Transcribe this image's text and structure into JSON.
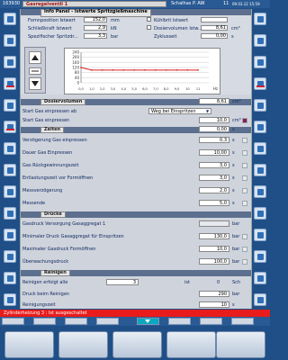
{
  "topbar": {
    "id": "163930",
    "title": "Gasregelventil 1",
    "user": "Schalhas P. AW",
    "counter": "11",
    "datetime": "09.03.12 15:59"
  },
  "info_panel": {
    "title": "Info Panel - Istwerte Spritzgießmaschine",
    "rows": [
      {
        "label": "Fornnposition Istwert",
        "value": "152,0",
        "unit": "mm",
        "cb_label": "Kühlbrit Istwert",
        "cb_value": "",
        "cb_unit": ""
      },
      {
        "label": "Schließkraft Istwert",
        "value": "2,9",
        "unit": "kN",
        "cb_label": "Dosiervolumen Istw...",
        "cb_value": "8,61",
        "cb_unit": "cm³"
      },
      {
        "label": "Spezifischer Spritzdr...",
        "value": "3,3",
        "unit": "bar",
        "cb_label": "Zyklusseit",
        "cb_value": "0,00",
        "cb_unit": "s"
      }
    ]
  },
  "chart_data": {
    "type": "line",
    "x": [
      0.0,
      1.0,
      2.0,
      3.0,
      4.0,
      5.0,
      6.0,
      7.0,
      8.0,
      9.0,
      10.0,
      11.0
    ],
    "values": [
      120,
      100,
      100,
      100,
      100,
      100,
      100,
      100,
      100,
      100,
      100,
      100
    ],
    "yticks": [
      "240",
      "200",
      "160",
      "120",
      "80",
      "40",
      "0"
    ],
    "xticks": [
      "0,0",
      "1,0",
      "2,0",
      "3,0",
      "4,0",
      "5,0",
      "6,0",
      "7,0",
      "8,0",
      "9,0",
      "10",
      "11"
    ],
    "xunit": "Hz",
    "ylim": [
      0,
      240
    ],
    "xlim": [
      0,
      12
    ]
  },
  "dosiervolumen": {
    "title": "Dosiervolumen",
    "value": "8,61",
    "unit": "cm³"
  },
  "start": {
    "rows": [
      {
        "label": "Start Gas einpressen ab",
        "value": "Weg bei Einspritzen",
        "unit": ""
      },
      {
        "label": "Start Gas einpressen",
        "value": "10,0",
        "unit": "cm³"
      }
    ]
  },
  "zeiten": {
    "title": "Zeiten",
    "value": "0,00",
    "unit": "s",
    "rows": [
      {
        "label": "Verzögerung Gas einpressen",
        "value": "0,3",
        "unit": "s"
      },
      {
        "label": "Dauer Gas Einpressen",
        "value": "10,00",
        "unit": "s"
      },
      {
        "label": "Gas Rückgewinnungszeit",
        "value": "3,0",
        "unit": "s"
      },
      {
        "label": "Entlastungszeit vor Formöffnen",
        "value": "3,0",
        "unit": "s"
      },
      {
        "label": "Messverzögerung",
        "value": "2,0",
        "unit": "s"
      },
      {
        "label": "Messende",
        "value": "5,0",
        "unit": "s"
      }
    ]
  },
  "druecke": {
    "title": "Drücke",
    "rows": [
      {
        "label": "Gasdruck Versorgung Gasaggregat 1",
        "value": "",
        "unit": "bar"
      },
      {
        "label": "Minimaler Druck Gasaggregat für Einspritzen",
        "value": "130,0",
        "unit": "bar"
      },
      {
        "label": "Maximaler Gasdruck Formöffnen",
        "value": "10,0",
        "unit": "bar"
      },
      {
        "label": "Überwachungsdruck",
        "value": "100,0",
        "unit": "bar"
      }
    ]
  },
  "reinigen": {
    "title": "Reinigen",
    "rows": [
      {
        "label": "Reinigen erfolgt alle",
        "value": "3",
        "ist_label": "ist",
        "ist_value": "0",
        "unit": "Sch"
      },
      {
        "label": "Druck beim Reinigen",
        "value": "290",
        "unit": "bar"
      },
      {
        "label": "Reinigungszeit",
        "value": "10",
        "unit": "s"
      }
    ]
  },
  "status": {
    "message": "Zylinderheizung 3 : Ist ausgeschaltet"
  },
  "colors": {
    "alarm": "#e81c1c",
    "accent": "#0aa7c0",
    "frame": "#1f4f86"
  }
}
